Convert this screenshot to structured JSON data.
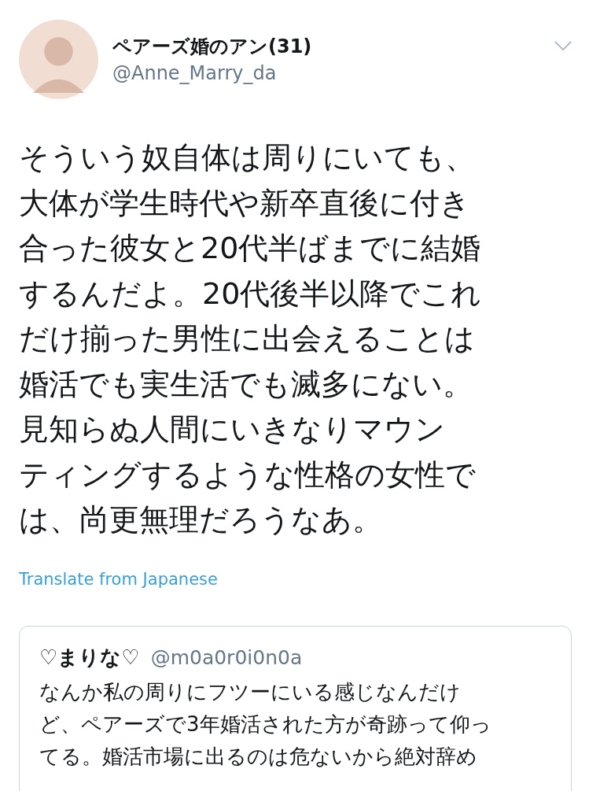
{
  "author": {
    "name": "ペアーズ婚のアン(31)",
    "handle": "@Anne_Marry_da"
  },
  "tweet_lines": [
    "そういう奴自体は周りにいても、",
    "大体が学生時代や新卒直後に付き",
    "合った彼女と20代半ばまでに結婚",
    "するんだよ。20代後半以降でこれ",
    "だけ揃った男性に出会えることは",
    "婚活でも実生活でも滅多にない。",
    "見知らぬ人間にいきなりマウン",
    "ティングするような性格の女性で",
    "は、尚更無理だろうなあ。"
  ],
  "translate_link": "Translate from Japanese",
  "quoted_tweet": {
    "name": "♡まりな♡",
    "handle": "@m0a0r0i0n0a",
    "lines": [
      "なんか私の周りにフツーにいる感じなんだけ",
      "ど、ペアーズで3年婚活された方が奇跡って仰っ",
      "てる。婚活市場に出るのは危ないから絶対辞め"
    ]
  }
}
